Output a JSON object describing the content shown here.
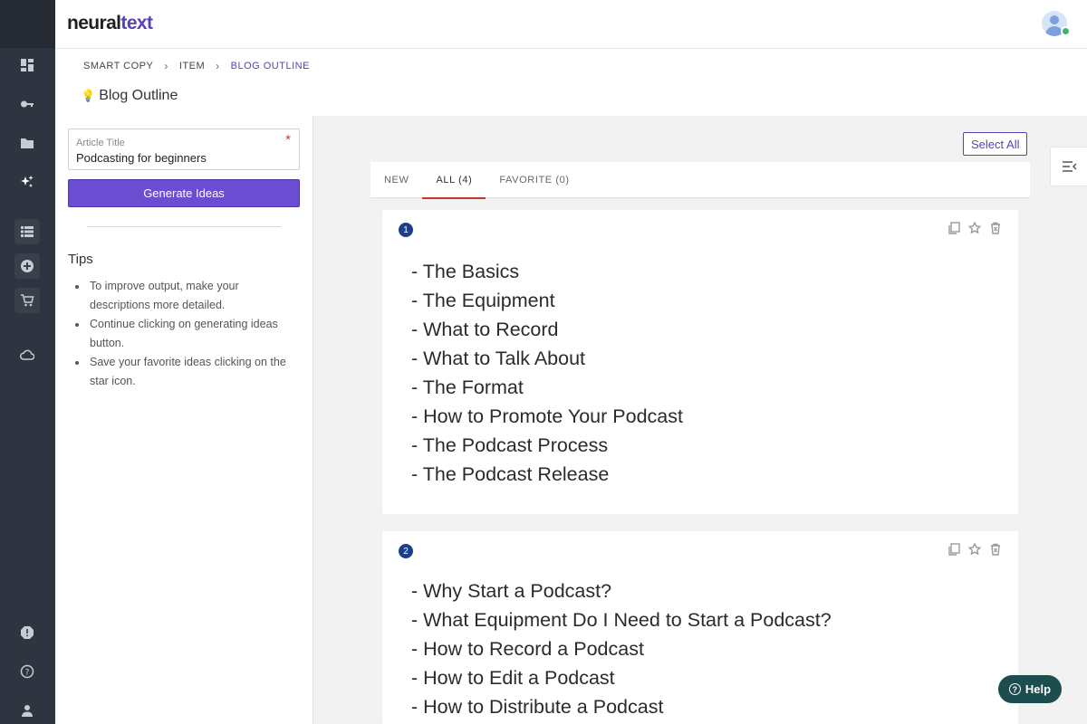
{
  "app": {
    "logo_main": "neural",
    "logo_accent": "text"
  },
  "breadcrumb": {
    "items": [
      "SMART COPY",
      "ITEM",
      "BLOG OUTLINE"
    ]
  },
  "page": {
    "title": "Blog Outline"
  },
  "form": {
    "article_title_label": "Article Title",
    "article_title_value": "Podcasting for beginners",
    "required_mark": "*",
    "generate_label": "Generate Ideas"
  },
  "tips": {
    "title": "Tips",
    "items": [
      "To improve output, make your descriptions more detailed.",
      "Continue clicking on generating ideas button.",
      "Save your favorite ideas clicking on the star icon."
    ]
  },
  "results": {
    "select_all_label": "Select All",
    "tabs": [
      "NEW",
      "ALL (4)",
      "FAVORITE (0)"
    ],
    "active_tab": "ALL (4)",
    "cards": [
      {
        "number": "1",
        "lines": [
          "- The Basics",
          "- The Equipment",
          "- What to Record",
          "- What to Talk About",
          "- The Format",
          "- How to Promote Your Podcast",
          "- The Podcast Process",
          "- The Podcast Release"
        ]
      },
      {
        "number": "2",
        "lines": [
          "- Why Start a Podcast?",
          "- What Equipment Do I Need to Start a Podcast?",
          "- How to Record a Podcast",
          "- How to Edit a Podcast",
          "- How to Distribute a Podcast"
        ]
      }
    ]
  },
  "help": {
    "label": "Help"
  },
  "icons": {
    "rail": [
      "dashboard-icon",
      "key-icon",
      "folder-icon",
      "sparkles-icon",
      "list-icon",
      "add-circle-icon",
      "cart-icon",
      "cloud-icon",
      "alert-icon",
      "help-circle-icon",
      "user-icon"
    ],
    "card_actions": [
      "copy-icon",
      "star-icon",
      "delete-icon"
    ]
  },
  "colors": {
    "brand": "#5b40b8",
    "primary_button": "#6a4dd0",
    "sidebar": "#2e3440",
    "active_tab_underline": "#c0392b",
    "card_badge": "#1b3f8b",
    "help_button": "#1e4d4f"
  }
}
